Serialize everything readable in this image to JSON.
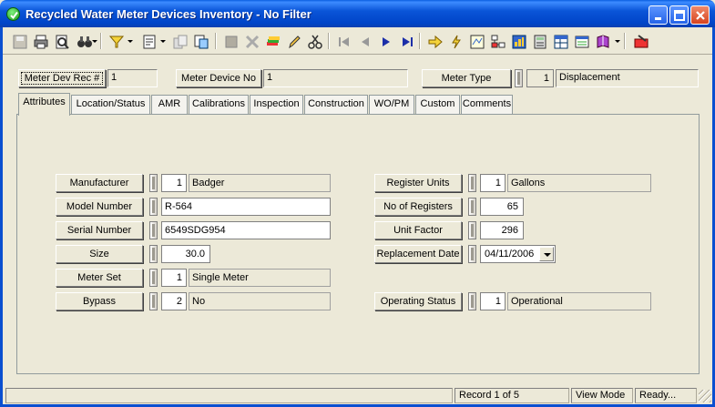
{
  "window": {
    "title": "Recycled Water Meter Devices Inventory - No Filter"
  },
  "header": {
    "rec_label": "Meter Dev Rec #",
    "rec_value": "1",
    "device_label": "Meter Device No",
    "device_value": "1",
    "type_label": "Meter Type",
    "type_code": "1",
    "type_desc": "Displacement"
  },
  "tabs": [
    {
      "label": "Attributes"
    },
    {
      "label": "Location/Status"
    },
    {
      "label": "AMR"
    },
    {
      "label": "Calibrations"
    },
    {
      "label": "Inspection"
    },
    {
      "label": "Construction"
    },
    {
      "label": "WO/PM"
    },
    {
      "label": "Custom"
    },
    {
      "label": "Comments"
    }
  ],
  "left_fields": {
    "manufacturer": {
      "label": "Manufacturer",
      "code": "1",
      "desc": "Badger"
    },
    "model": {
      "label": "Model Number",
      "value": "R-564"
    },
    "serial": {
      "label": "Serial Number",
      "value": "6549SDG954"
    },
    "size": {
      "label": "Size",
      "value": "30.0"
    },
    "meter_set": {
      "label": "Meter Set",
      "code": "1",
      "desc": "Single Meter"
    },
    "bypass": {
      "label": "Bypass",
      "code": "2",
      "desc": "No"
    }
  },
  "right_fields": {
    "register_units": {
      "label": "Register Units",
      "code": "1",
      "desc": "Gallons"
    },
    "num_registers": {
      "label": "No of Registers",
      "value": "65"
    },
    "unit_factor": {
      "label": "Unit Factor",
      "value": "296"
    },
    "replacement_date": {
      "label": "Replacement Date",
      "value": "04/11/2006"
    },
    "operating_status": {
      "label": "Operating Status",
      "code": "1",
      "desc": "Operational"
    }
  },
  "status": {
    "record": "Record 1 of 5",
    "mode": "View Mode",
    "state": "Ready..."
  },
  "icons": [
    "save-icon",
    "print-icon",
    "preview-icon",
    "binoculars-icon",
    "filter-icon",
    "report-icon",
    "copy-icon",
    "export-icon",
    "stop-icon",
    "delete-icon",
    "stack-icon",
    "pencil-icon",
    "scissors-icon",
    "first-icon",
    "prev-icon",
    "next-icon",
    "last-icon",
    "goto-icon",
    "lightning-icon",
    "map-icon",
    "tree-icon",
    "chart-icon",
    "calculator-icon",
    "grid-icon",
    "window-icon",
    "book-icon",
    "exit-icon"
  ],
  "colors": {
    "titlebar": "#0a55d8",
    "panel": "#ece9d8",
    "accent_green": "#1c9a1c"
  }
}
